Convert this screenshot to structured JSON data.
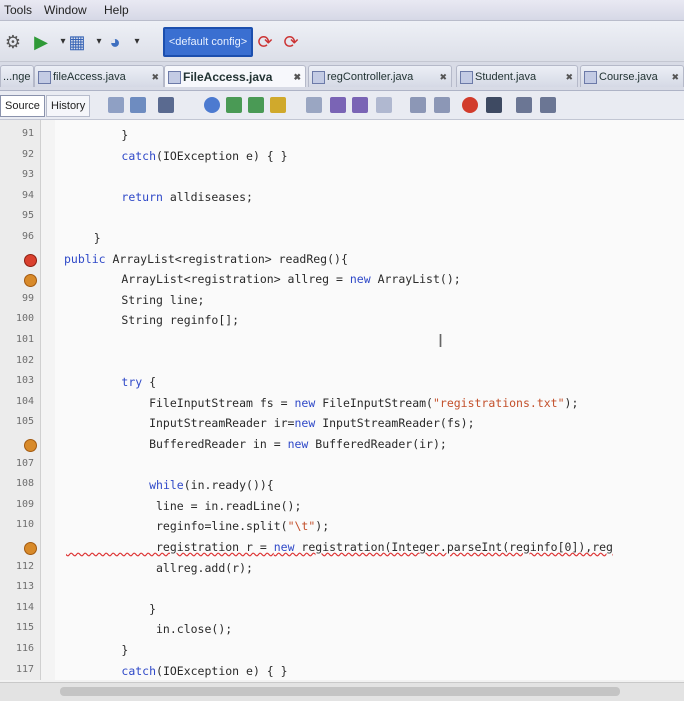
{
  "menu": {
    "tools": "Tools",
    "window": "Window",
    "help": "Help"
  },
  "toolbar": {
    "config_value": "<default config>"
  },
  "tabs": [
    {
      "label": "...nge",
      "active": false
    },
    {
      "label": "fileAccess.java",
      "active": false
    },
    {
      "label": "FileAccess.java",
      "active": true
    },
    {
      "label": "regController.java",
      "active": false
    },
    {
      "label": "Student.java",
      "active": false
    },
    {
      "label": "Course.java",
      "active": false
    }
  ],
  "editor_toolbar": {
    "source": "Source",
    "history": "History"
  },
  "lines": [
    {
      "n": "91",
      "code": "        }"
    },
    {
      "n": "92",
      "code": "        catch(IOException e) { }"
    },
    {
      "n": "93",
      "code": ""
    },
    {
      "n": "94",
      "code": "        return alldiseases;"
    },
    {
      "n": "95",
      "code": ""
    },
    {
      "n": "96",
      "code": "    }"
    },
    {
      "n": "",
      "code": "public ArrayList<registration> readReg(){"
    },
    {
      "n": "",
      "code": "        ArrayList<registration> allreg = new ArrayList();"
    },
    {
      "n": "99",
      "code": "        String line;"
    },
    {
      "n": "100",
      "code": "        String reginfo[];"
    },
    {
      "n": "101",
      "code": ""
    },
    {
      "n": "102",
      "code": ""
    },
    {
      "n": "103",
      "code": "        try {"
    },
    {
      "n": "104",
      "code": "            FileInputStream fs = new FileInputStream(\"registrations.txt\");"
    },
    {
      "n": "105",
      "code": "            InputStreamReader ir=new InputStreamReader(fs);"
    },
    {
      "n": "",
      "code": "            BufferedReader in = new BufferedReader(ir);"
    },
    {
      "n": "107",
      "code": ""
    },
    {
      "n": "108",
      "code": "            while(in.ready()){"
    },
    {
      "n": "109",
      "code": "             line = in.readLine();"
    },
    {
      "n": "110",
      "code": "             reginfo=line.split(\"\\t\");"
    },
    {
      "n": "",
      "code": "             registration r = new registration(Integer.parseInt(reginfo[0]),reg"
    },
    {
      "n": "112",
      "code": "             allreg.add(r);"
    },
    {
      "n": "113",
      "code": ""
    },
    {
      "n": "114",
      "code": "            }"
    },
    {
      "n": "115",
      "code": "             in.close();"
    },
    {
      "n": "116",
      "code": "        }"
    },
    {
      "n": "117",
      "code": "        catch(IOException e) { }"
    }
  ],
  "colors": {
    "keyword": "#2f49c8",
    "string": "#c3502b",
    "accent": "#3a6fd1"
  }
}
